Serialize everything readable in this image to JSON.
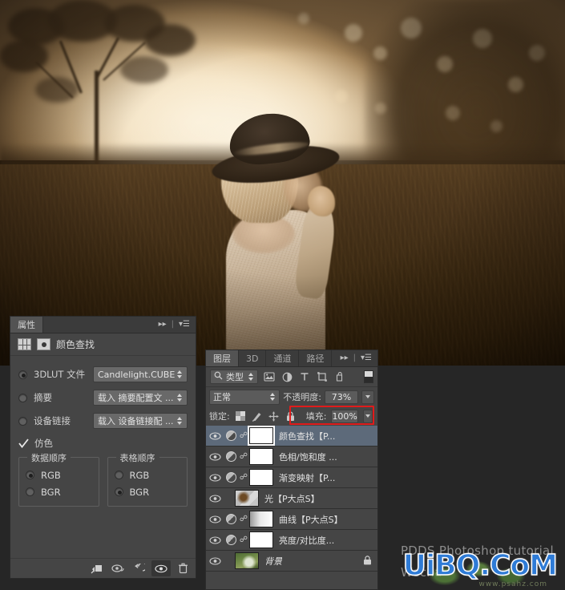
{
  "app": {
    "photo_alt": "Backlit sepia portrait of a woman in a wide-brim hat standing in a field at sunset"
  },
  "properties_panel": {
    "tab_label": "属性",
    "collapse_icon": "double-chevron-right-icon",
    "menu_icon": "panel-menu-icon",
    "header": {
      "grid_icon": "lut-grid-icon",
      "mask_icon": "adjustment-mask-icon",
      "title": "颜色查找"
    },
    "options": [
      {
        "label": "3DLUT 文件",
        "selected": true,
        "value": "Candlelight.CUBE"
      },
      {
        "label": "摘要",
        "selected": false,
        "value": "载入 摘要配置文 ..."
      },
      {
        "label": "设备链接",
        "selected": false,
        "value": "载入 设备链接配 ..."
      }
    ],
    "dither": {
      "label": "仿色",
      "checked": true
    },
    "groups": [
      {
        "legend": "数据顺序",
        "items": [
          {
            "label": "RGB",
            "selected": true
          },
          {
            "label": "BGR",
            "selected": false
          }
        ]
      },
      {
        "legend": "表格顺序",
        "items": [
          {
            "label": "RGB",
            "selected": false
          },
          {
            "label": "BGR",
            "selected": true
          }
        ]
      }
    ],
    "footer_buttons": [
      {
        "name": "clip-to-layer-button",
        "icon": "clip-mask-icon"
      },
      {
        "name": "previous-state-button",
        "icon": "eye-history-icon"
      },
      {
        "name": "reset-button",
        "icon": "reset-arrow-icon"
      },
      {
        "name": "toggle-visibility-button",
        "icon": "eye-icon",
        "active": true
      },
      {
        "name": "delete-layer-button",
        "icon": "trash-icon"
      }
    ]
  },
  "layers_panel": {
    "tabs": [
      {
        "label": "图层",
        "active": true
      },
      {
        "label": "3D",
        "active": false
      },
      {
        "label": "通道",
        "active": false
      },
      {
        "label": "路径",
        "active": false
      }
    ],
    "collapse_icon": "double-chevron-right-icon",
    "menu_icon": "panel-menu-icon",
    "filter": {
      "search_icon": "search-icon",
      "kind_label": "类型",
      "icons": [
        "pixel-layer-filter-icon",
        "adjustment-layer-filter-icon",
        "type-layer-filter-icon",
        "shape-layer-filter-icon",
        "smart-object-filter-icon"
      ],
      "toggle_icon": "filter-toggle-switch"
    },
    "blend": {
      "mode": "正常",
      "opacity_label": "不透明度:",
      "opacity_value": "73%",
      "highlight_color": "#e01b1b"
    },
    "lock": {
      "label": "锁定:",
      "icons": [
        "lock-transparent-pixels-icon",
        "lock-image-pixels-icon",
        "lock-position-icon",
        "lock-all-icon"
      ],
      "fill_label": "填充:",
      "fill_value": "100%"
    },
    "layers": [
      {
        "name": "颜色查找【P...",
        "visible": true,
        "type": "adjustment",
        "selected": true,
        "thumb": "white",
        "locked": false,
        "italic": false
      },
      {
        "name": "色相/饱和度 ...",
        "visible": true,
        "type": "adjustment",
        "selected": false,
        "thumb": "white",
        "locked": false,
        "italic": false
      },
      {
        "name": "渐变映射【P...",
        "visible": true,
        "type": "adjustment",
        "selected": false,
        "thumb": "white",
        "locked": false,
        "italic": false
      },
      {
        "name": "光【P大点S】",
        "visible": true,
        "type": "pixel",
        "selected": false,
        "thumb": "photo1",
        "locked": false,
        "italic": false
      },
      {
        "name": "曲线【P大点S】",
        "visible": true,
        "type": "adjustment",
        "selected": false,
        "thumb": "gradient",
        "locked": false,
        "italic": false
      },
      {
        "name": "亮度/对比度...",
        "visible": true,
        "type": "adjustment",
        "selected": false,
        "thumb": "white",
        "locked": false,
        "italic": false
      },
      {
        "name": "背景",
        "visible": true,
        "type": "pixel",
        "selected": false,
        "thumb": "photo2",
        "locked": true,
        "italic": true
      }
    ]
  },
  "watermark": {
    "line1": "PDDS Photoshop tutorial",
    "line2": "Wecha",
    "overlay": "UiBQ.CoM",
    "small": "www.psahz.com"
  }
}
